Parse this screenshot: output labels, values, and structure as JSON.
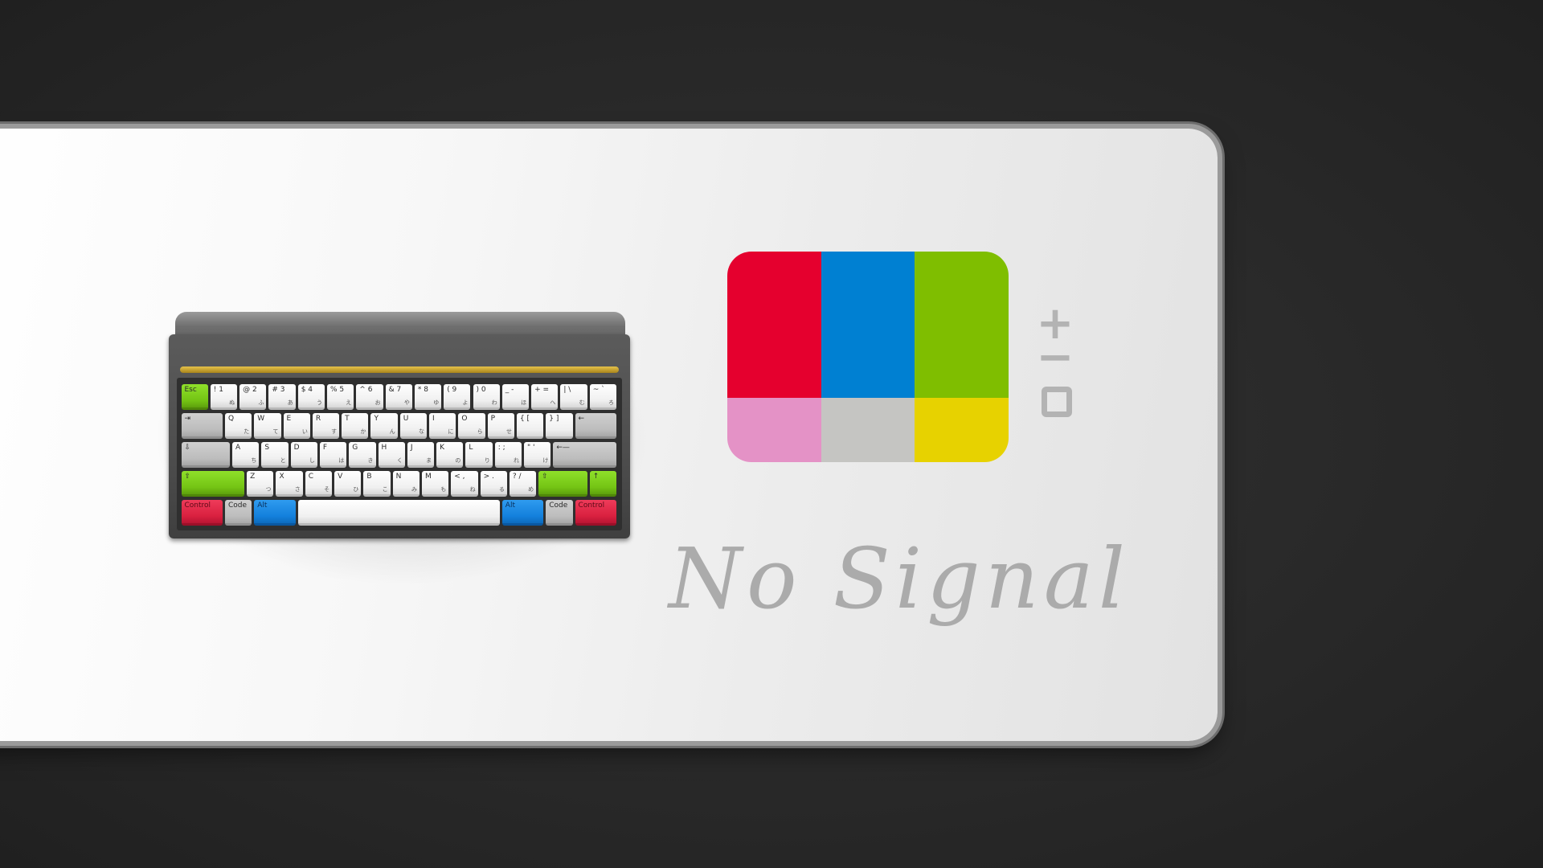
{
  "screen": {
    "message": "No Signal",
    "colors": {
      "background": "#2b2b2b",
      "deskmat": "#f2f2f2",
      "message_text": "#ababab",
      "control_icons": "#b3b3b3"
    }
  },
  "test_pattern": {
    "bars": [
      {
        "name": "red",
        "color": "#e5002e"
      },
      {
        "name": "blue",
        "color": "#0080d2"
      },
      {
        "name": "green",
        "color": "#7fbe00"
      },
      {
        "name": "pink",
        "color": "#e492c6"
      },
      {
        "name": "gray",
        "color": "#c5c5c2"
      },
      {
        "name": "yellow",
        "color": "#e7d200"
      }
    ]
  },
  "controls": {
    "icons": [
      "plus-icon",
      "minus-icon",
      "square-icon"
    ]
  },
  "keyboard": {
    "colors": {
      "white_keys": "#f2f2f2",
      "gray_keys": "#c4c4c4",
      "green_keys": "#7ccc17",
      "red_keys": "#d9203f",
      "blue_keys": "#1380dc"
    },
    "rows": [
      [
        {
          "top": "Esc",
          "bottom": "",
          "color": "green"
        },
        {
          "top": "! 1",
          "bottom": "ぬ",
          "color": "white"
        },
        {
          "top": "@ 2",
          "bottom": "ふ",
          "color": "white"
        },
        {
          "top": "# 3",
          "bottom": "あ",
          "color": "white"
        },
        {
          "top": "$ 4",
          "bottom": "う",
          "color": "white"
        },
        {
          "top": "% 5",
          "bottom": "え",
          "color": "white"
        },
        {
          "top": "^ 6",
          "bottom": "お",
          "color": "white"
        },
        {
          "top": "& 7",
          "bottom": "や",
          "color": "white"
        },
        {
          "top": "* 8",
          "bottom": "ゆ",
          "color": "white"
        },
        {
          "top": "( 9",
          "bottom": "よ",
          "color": "white"
        },
        {
          "top": ") 0",
          "bottom": "わ",
          "color": "white"
        },
        {
          "top": "_ -",
          "bottom": "ほ",
          "color": "white"
        },
        {
          "top": "+ =",
          "bottom": "へ",
          "color": "white"
        },
        {
          "top": "| \\",
          "bottom": "む",
          "color": "white"
        },
        {
          "top": "~ `",
          "bottom": "ろ",
          "color": "white"
        }
      ],
      [
        {
          "top": "⇥",
          "bottom": "",
          "color": "gray"
        },
        {
          "top": "Q",
          "bottom": "た",
          "color": "white"
        },
        {
          "top": "W",
          "bottom": "て",
          "color": "white"
        },
        {
          "top": "E",
          "bottom": "い",
          "color": "white"
        },
        {
          "top": "R",
          "bottom": "す",
          "color": "white"
        },
        {
          "top": "T",
          "bottom": "か",
          "color": "white"
        },
        {
          "top": "Y",
          "bottom": "ん",
          "color": "white"
        },
        {
          "top": "U",
          "bottom": "な",
          "color": "white"
        },
        {
          "top": "I",
          "bottom": "に",
          "color": "white"
        },
        {
          "top": "O",
          "bottom": "ら",
          "color": "white"
        },
        {
          "top": "P",
          "bottom": "せ",
          "color": "white"
        },
        {
          "top": "{ [",
          "bottom": "",
          "color": "white"
        },
        {
          "top": "} ]",
          "bottom": "",
          "color": "white"
        },
        {
          "top": "←",
          "bottom": "",
          "color": "gray"
        }
      ],
      [
        {
          "top": "⇩",
          "bottom": "",
          "color": "gray"
        },
        {
          "top": "A",
          "bottom": "ち",
          "color": "white"
        },
        {
          "top": "S",
          "bottom": "と",
          "color": "white"
        },
        {
          "top": "D",
          "bottom": "し",
          "color": "white"
        },
        {
          "top": "F",
          "bottom": "は",
          "color": "white"
        },
        {
          "top": "G",
          "bottom": "き",
          "color": "white"
        },
        {
          "top": "H",
          "bottom": "く",
          "color": "white"
        },
        {
          "top": "J",
          "bottom": "ま",
          "color": "white"
        },
        {
          "top": "K",
          "bottom": "の",
          "color": "white"
        },
        {
          "top": "L",
          "bottom": "り",
          "color": "white"
        },
        {
          "top": ": ;",
          "bottom": "れ",
          "color": "white"
        },
        {
          "top": "\" '",
          "bottom": "け",
          "color": "white"
        },
        {
          "top": "←—",
          "bottom": "",
          "color": "gray"
        }
      ],
      [
        {
          "top": "⇧",
          "bottom": "",
          "color": "green"
        },
        {
          "top": "Z",
          "bottom": "つ",
          "color": "white"
        },
        {
          "top": "X",
          "bottom": "さ",
          "color": "white"
        },
        {
          "top": "C",
          "bottom": "そ",
          "color": "white"
        },
        {
          "top": "V",
          "bottom": "ひ",
          "color": "white"
        },
        {
          "top": "B",
          "bottom": "こ",
          "color": "white"
        },
        {
          "top": "N",
          "bottom": "み",
          "color": "white"
        },
        {
          "top": "M",
          "bottom": "も",
          "color": "white"
        },
        {
          "top": "< ,",
          "bottom": "ね",
          "color": "white"
        },
        {
          "top": "> .",
          "bottom": "る",
          "color": "white"
        },
        {
          "top": "? /",
          "bottom": "め",
          "color": "white"
        },
        {
          "top": "⇧",
          "bottom": "",
          "color": "green"
        },
        {
          "top": "↑",
          "bottom": "",
          "color": "green"
        }
      ],
      [
        {
          "top": "Control",
          "bottom": "",
          "color": "red"
        },
        {
          "top": "Code",
          "bottom": "",
          "color": "gray"
        },
        {
          "top": "Alt",
          "bottom": "",
          "color": "blue"
        },
        {
          "top": "",
          "bottom": "",
          "color": "white"
        },
        {
          "top": "Alt",
          "bottom": "",
          "color": "blue"
        },
        {
          "top": "Code",
          "bottom": "",
          "color": "gray"
        },
        {
          "top": "Control",
          "bottom": "",
          "color": "red"
        }
      ]
    ]
  }
}
